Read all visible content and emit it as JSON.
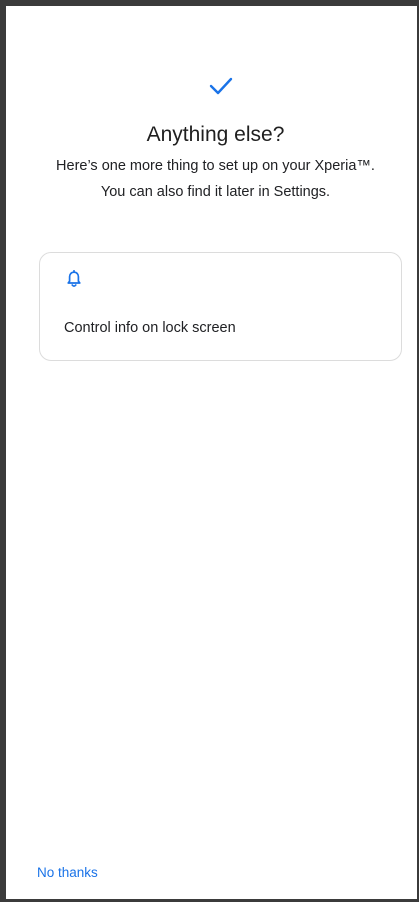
{
  "header": {
    "title": "Anything else?",
    "subtitle_line1": "Here’s one more thing to set up on your Xperia™.",
    "subtitle_line2": "You can also find it later in Settings."
  },
  "option_card": {
    "icon": "bell-icon",
    "label": "Control info on lock screen"
  },
  "footer": {
    "no_thanks_label": "No thanks"
  },
  "colors": {
    "accent": "#1a73e8",
    "text": "#202124",
    "card_border": "#dcdcdc",
    "frame": "#3b3b3b"
  }
}
